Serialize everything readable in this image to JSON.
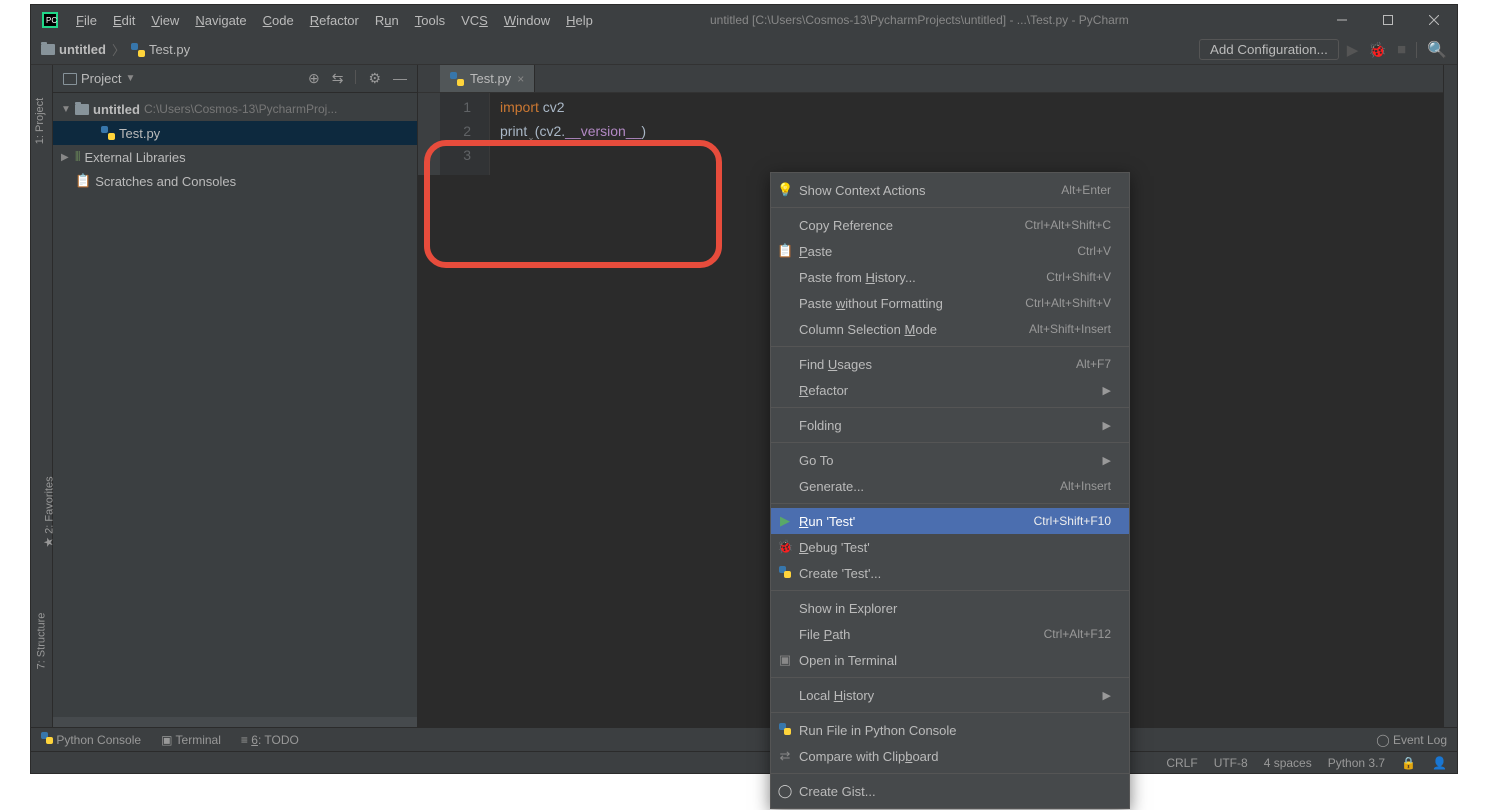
{
  "titlebar": {
    "menus": [
      "File",
      "Edit",
      "View",
      "Navigate",
      "Code",
      "Refactor",
      "Run",
      "Tools",
      "VCS",
      "Window",
      "Help"
    ],
    "title": "untitled [C:\\Users\\Cosmos-13\\PycharmProjects\\untitled] - ...\\Test.py - PyCharm"
  },
  "breadcrumb": {
    "project": "untitled",
    "file": "Test.py"
  },
  "navbar": {
    "add_config": "Add Configuration..."
  },
  "sidebar": {
    "title": "Project",
    "project": {
      "name": "untitled",
      "path": "C:\\Users\\Cosmos-13\\PycharmProj..."
    },
    "file": "Test.py",
    "ext_lib": "External Libraries",
    "scratches": "Scratches and Consoles"
  },
  "editor": {
    "tab": "Test.py",
    "lines": [
      "1",
      "2",
      "3"
    ],
    "code": {
      "l1_kw": "import",
      "l1_mod": "cv2",
      "l2_fn": "print",
      "l2_open": "(cv2.",
      "l2_attr": "__version__",
      "l2_close": ")"
    }
  },
  "left_tabs": {
    "project": "1: Project",
    "favorites": "2: Favorites",
    "structure": "7: Structure"
  },
  "context_menu": [
    {
      "icon": "bulb",
      "label": "Show Context Actions",
      "shortcut": "Alt+Enter"
    },
    {
      "sep": true
    },
    {
      "label": "Copy Reference",
      "shortcut": "Ctrl+Alt+Shift+C"
    },
    {
      "icon": "paste",
      "label": "Paste",
      "u": 0,
      "shortcut": "Ctrl+V"
    },
    {
      "label": "Paste from History...",
      "u": 11,
      "shortcut": "Ctrl+Shift+V"
    },
    {
      "label": "Paste without Formatting",
      "u": 6,
      "shortcut": "Ctrl+Alt+Shift+V"
    },
    {
      "label": "Column Selection Mode",
      "u": 17,
      "shortcut": "Alt+Shift+Insert"
    },
    {
      "sep": true
    },
    {
      "label": "Find Usages",
      "u": 5,
      "shortcut": "Alt+F7"
    },
    {
      "label": "Refactor",
      "u": 0,
      "submenu": true
    },
    {
      "sep": true
    },
    {
      "label": "Folding",
      "submenu": true
    },
    {
      "sep": true
    },
    {
      "label": "Go To",
      "submenu": true
    },
    {
      "label": "Generate...",
      "shortcut": "Alt+Insert"
    },
    {
      "sep": true
    },
    {
      "icon": "run",
      "label": "Run 'Test'",
      "u": 0,
      "shortcut": "Ctrl+Shift+F10",
      "highlighted": true
    },
    {
      "icon": "debug",
      "label": "Debug 'Test'",
      "u": 0
    },
    {
      "icon": "python",
      "label": "Create 'Test'..."
    },
    {
      "sep": true
    },
    {
      "label": "Show in Explorer"
    },
    {
      "label": "File Path",
      "u": 5,
      "shortcut": "Ctrl+Alt+F12"
    },
    {
      "icon": "terminal",
      "label": "Open in Terminal"
    },
    {
      "sep": true
    },
    {
      "label": "Local History",
      "u": 6,
      "submenu": true
    },
    {
      "sep": true
    },
    {
      "icon": "python",
      "label": "Run File in Python Console"
    },
    {
      "icon": "compare",
      "label": "Compare with Clipboard",
      "u": 17
    },
    {
      "sep": true
    },
    {
      "icon": "github",
      "label": "Create Gist..."
    }
  ],
  "bottom": {
    "console": "Python Console",
    "terminal": "Terminal",
    "todo": "6: TODO",
    "eventlog": "Event Log"
  },
  "status": {
    "crlf": "CRLF",
    "enc": "UTF-8",
    "indent": "4 spaces",
    "python": "Python 3.7"
  }
}
